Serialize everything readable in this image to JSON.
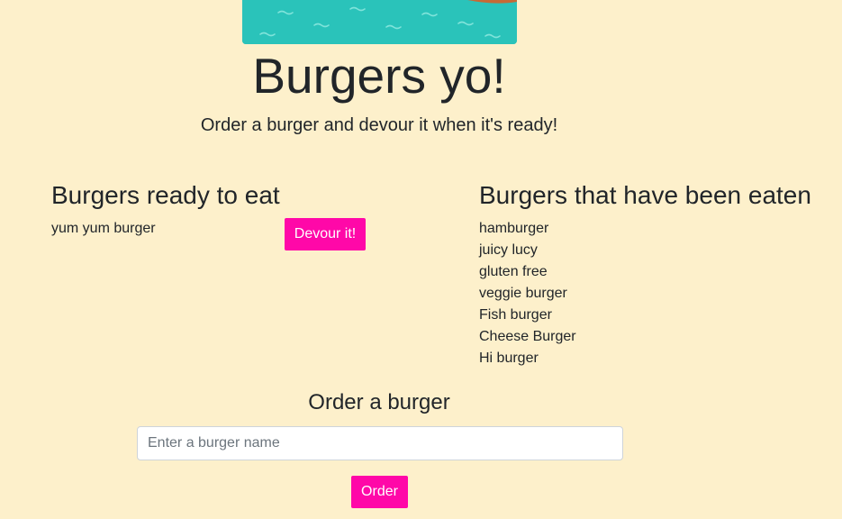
{
  "header": {
    "image_name": "burger-banner-image",
    "title": "Burgers yo!",
    "subtitle": "Order a burger and devour it when it's ready!"
  },
  "ready_section": {
    "heading": "Burgers ready to eat",
    "items": [
      {
        "name": "yum yum burger",
        "button_label": "Devour it!"
      }
    ]
  },
  "eaten_section": {
    "heading": "Burgers that have been eaten",
    "items": [
      "hamburger",
      "juicy lucy",
      "gluten free",
      "veggie burger",
      "Fish burger",
      "Cheese Burger",
      "Hi burger"
    ]
  },
  "order_form": {
    "heading": "Order a burger",
    "input_value": "",
    "input_placeholder": "Enter a burger name",
    "button_label": "Order"
  },
  "colors": {
    "background": "#fdf0cb",
    "accent": "#ff08a8",
    "banner": "#2ac3ba"
  }
}
